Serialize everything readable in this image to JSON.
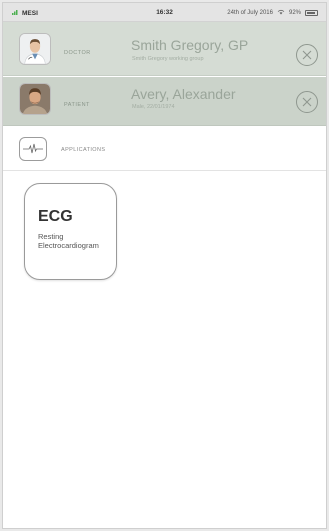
{
  "status_bar": {
    "carrier": "MESI",
    "time": "16:32",
    "date": "24th of July 2016",
    "battery": "92%",
    "icons": [
      "signal-icon",
      "wifi-icon",
      "battery-icon"
    ]
  },
  "doctor": {
    "label": "DOCTOR",
    "name": "Smith Gregory, GP",
    "group": "Smith Gregory working group"
  },
  "patient": {
    "label": "PATIENT",
    "name": "Avery, Alexander",
    "details": "Male, 22/01/1974"
  },
  "applications": {
    "label": "APPLICATIONS",
    "icon": "ecg-wave-icon",
    "tiles": [
      {
        "title": "ECG",
        "description": "Resting Electrocardiogram"
      }
    ]
  },
  "colors": {
    "doctor_row": "#d5dcd4",
    "patient_row": "#cbd3ca",
    "accent_green": "#5cb85c"
  }
}
